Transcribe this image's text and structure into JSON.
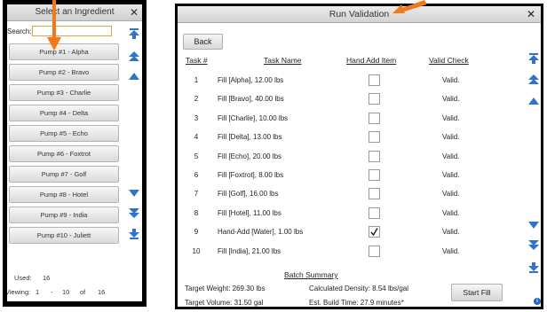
{
  "ingredient_dialog": {
    "title": "Select an Ingredient",
    "close": "✕",
    "search_label": "Search:",
    "search_value": "",
    "pumps": [
      {
        "label": "Pump #1 - Alpha"
      },
      {
        "label": "Pump #2 - Bravo"
      },
      {
        "label": "Pump #3 - Charlie"
      },
      {
        "label": "Pump #4 - Delta"
      },
      {
        "label": "Pump #5 - Echo"
      },
      {
        "label": "Pump #6 - Foxtrot"
      },
      {
        "label": "Pump #7 - Golf"
      },
      {
        "label": "Pump #8 - Hotel"
      },
      {
        "label": "Pump #9 - India"
      },
      {
        "label": "Pump #10 - Juliett"
      }
    ],
    "footer": {
      "used_label": "Used:",
      "used_value": "16",
      "viewing_label": "Viewing:",
      "viewing_from": "1",
      "viewing_dash": "-",
      "viewing_to": "10",
      "viewing_of": "of",
      "viewing_total": "16"
    }
  },
  "validation_dialog": {
    "title": "Run Validation",
    "close": "✕",
    "back_label": "Back",
    "columns": {
      "task_num": "Task #",
      "task_name": "Task Name",
      "hand_add": "Hand Add Item",
      "valid_check": "Valid Check"
    },
    "rows": [
      {
        "num": "1",
        "name": "Fill [Alpha], 12.00 lbs",
        "hand_add": false,
        "valid": "Valid."
      },
      {
        "num": "2",
        "name": "Fill [Bravo], 40.00 lbs",
        "hand_add": false,
        "valid": "Valid."
      },
      {
        "num": "3",
        "name": "Fill [Charlie], 10.00 lbs",
        "hand_add": false,
        "valid": "Valid."
      },
      {
        "num": "4",
        "name": "Fill [Delta], 13.00 lbs",
        "hand_add": false,
        "valid": "Valid."
      },
      {
        "num": "5",
        "name": "Fill [Echo], 20.00 lbs",
        "hand_add": false,
        "valid": "Valid."
      },
      {
        "num": "6",
        "name": "Fill [Foxtrot], 8.00 lbs",
        "hand_add": false,
        "valid": "Valid."
      },
      {
        "num": "7",
        "name": "Fill [Golf], 16.00 lbs",
        "hand_add": false,
        "valid": "Valid."
      },
      {
        "num": "8",
        "name": "Fill [Hotel], 11.00 lbs",
        "hand_add": false,
        "valid": "Valid."
      },
      {
        "num": "9",
        "name": "Hand-Add [Water], 1.00 lbs",
        "hand_add": true,
        "valid": "Valid."
      },
      {
        "num": "10",
        "name": "Fill [India], 21.00 lbs",
        "hand_add": false,
        "valid": "Valid."
      }
    ],
    "summary": {
      "title": "Batch Summary",
      "target_weight": "Target Weight: 269.30 lbs",
      "target_volume": "Target Volume: 31.50 gal",
      "calc_density": "Calculated Density: 8.54 lbs/gal",
      "build_time": "Est. Build Time: 27.9 minutes*"
    },
    "start_label": "Start Fill",
    "info_glyph": "i"
  },
  "colors": {
    "pointer": "#f07a1a",
    "scroll_arrow": "#2f74c8",
    "frame": "#000000"
  },
  "icons": [
    "close-icon",
    "scroll-top-icon",
    "page-up-icon",
    "line-up-icon",
    "line-down-icon",
    "page-down-icon",
    "scroll-bottom-icon",
    "info-icon",
    "checkmark-icon"
  ]
}
